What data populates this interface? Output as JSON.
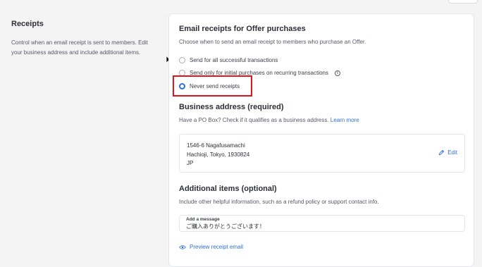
{
  "sidebar": {
    "title": "Receipts",
    "description": "Control when an email receipt is sent to members. Edit your business address and include additional items."
  },
  "email_receipts": {
    "title": "Email receipts for Offer purchases",
    "subtitle": "Choose when to send an email receipt to members who purchase an Offer.",
    "options": [
      {
        "label": "Send for all successful transactions",
        "selected": false
      },
      {
        "label": "Send only for initial purchases on recurring transactions",
        "selected": false,
        "has_info_icon": true
      },
      {
        "label": "Never send receipts",
        "selected": true
      }
    ]
  },
  "business_address": {
    "title": "Business address (required)",
    "subtitle": "Have a PO Box? Check if it qualifies as a business address.",
    "learn_more": "Learn more",
    "lines": [
      "1546-6 Nagafusamachi",
      "Hachioji, Tokyo, 1930824",
      "JP"
    ],
    "edit_label": "Edit"
  },
  "additional_items": {
    "title": "Additional items (optional)",
    "subtitle": "Include other helpful information, such as a refund policy or support contact info.",
    "message_label": "Add a message",
    "message_value": "ご購入ありがとうございます！"
  },
  "preview_label": "Preview receipt email",
  "icons": {
    "cursor": "mouse-pointer-icon",
    "info": "info-icon",
    "edit": "pencil-icon",
    "preview": "eye-icon"
  },
  "colors": {
    "accent": "#2f6fd6",
    "highlight": "#e0151b",
    "background": "#f4f4f5"
  }
}
